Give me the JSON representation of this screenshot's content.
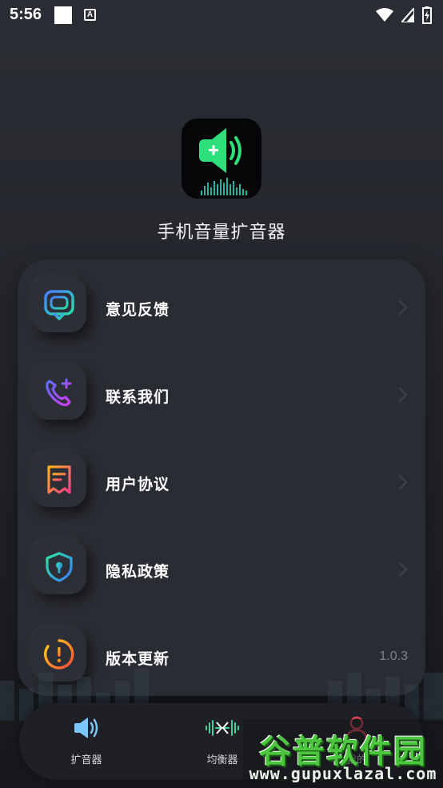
{
  "status_bar": {
    "time": "5:56",
    "badge_letter": "A"
  },
  "app": {
    "name": "手机音量扩音器"
  },
  "menu": {
    "items": [
      {
        "label": "意见反馈",
        "icon": "feedback-icon",
        "trailing": "chevron"
      },
      {
        "label": "联系我们",
        "icon": "phone-contact-icon",
        "trailing": "chevron"
      },
      {
        "label": "用户协议",
        "icon": "document-icon",
        "trailing": "chevron"
      },
      {
        "label": "隐私政策",
        "icon": "shield-keyhole-icon",
        "trailing": "chevron"
      },
      {
        "label": "版本更新",
        "icon": "update-alert-icon",
        "trailing": "version",
        "version": "1.0.3"
      }
    ]
  },
  "bottom_nav": {
    "items": [
      {
        "label": "扩音器",
        "icon": "speaker-icon"
      },
      {
        "label": "均衡器",
        "icon": "equalizer-icon"
      },
      {
        "label": "我的",
        "icon": "user-icon"
      }
    ]
  },
  "watermark": {
    "title": "谷普软件园",
    "url": "www.gupuxlazal.com"
  },
  "colors": {
    "background": "#24262c",
    "card": "#2a2c33",
    "accent_green": "#2fe07a",
    "nav": "#1e2025"
  }
}
